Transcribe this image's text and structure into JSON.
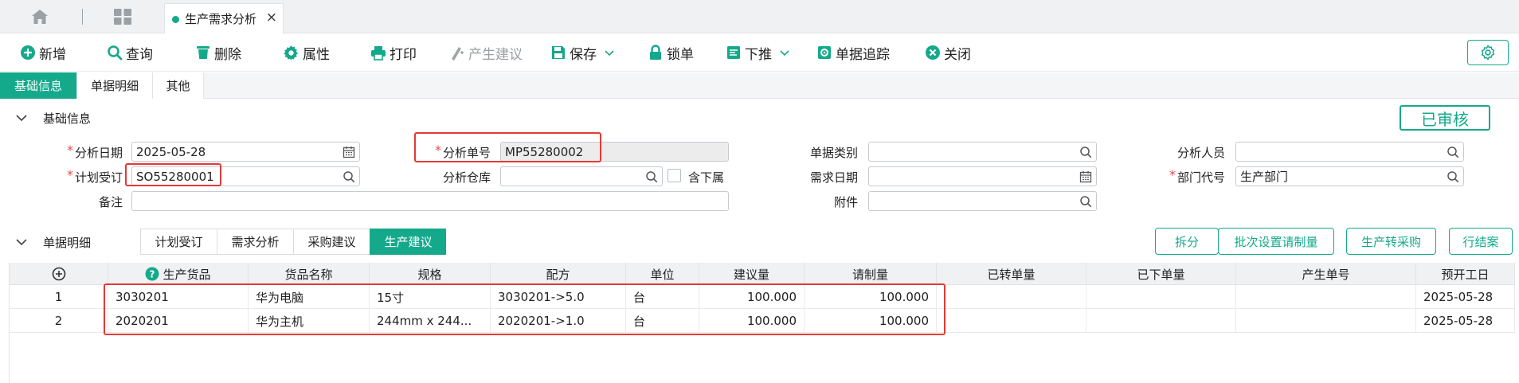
{
  "colors": {
    "accent": "#14a98b",
    "danger": "#e84b4b",
    "highlight": "#e53935"
  },
  "tabbar": {
    "home_icon": "home-icon",
    "grid_icon": "grid-icon",
    "active_tab": "生产需求分析",
    "close_glyph": "×"
  },
  "toolbar": {
    "new": "新增",
    "query": "查询",
    "delete": "删除",
    "props": "属性",
    "print": "打印",
    "generate": "产生建议",
    "save": "保存",
    "lock": "锁单",
    "push": "下推",
    "trace": "单据追踪",
    "close": "关闭"
  },
  "section_tabs": [
    "基础信息",
    "单据明细",
    "其他"
  ],
  "basic": {
    "title": "基础信息",
    "status": "已审核"
  },
  "form": {
    "date_label": "分析日期",
    "date_value": "2025-05-28",
    "plan_label": "计划受订",
    "plan_value": "SO55280001",
    "note_label": "备注",
    "note_value": "",
    "no_label": "分析单号",
    "no_value": "MP55280002",
    "warehouse_label": "分析仓库",
    "warehouse_value": "",
    "sub_label": "含下属",
    "type_label": "单据类别",
    "type_value": "",
    "demand_date_label": "需求日期",
    "demand_date_value": "",
    "attach_label": "附件",
    "attach_value": "",
    "staff_label": "分析人员",
    "staff_value": "",
    "dept_label": "部门代号",
    "dept_value": "生产部门"
  },
  "detail": {
    "title": "单据明细",
    "tabs": [
      "计划受订",
      "需求分析",
      "采购建议",
      "生产建议"
    ],
    "active_tab": 3,
    "actions": [
      "拆分",
      "批次设置请制量",
      "生产转采购",
      "行结案"
    ]
  },
  "table": {
    "headers": [
      "",
      "生产货品",
      "货品名称",
      "规格",
      "配方",
      "单位",
      "建议量",
      "请制量",
      "已转单量",
      "已下单量",
      "产生单号",
      "预开工日"
    ],
    "rows": [
      [
        "1",
        "3030201",
        "华为电脑",
        "15寸",
        "3030201->5.0",
        "台",
        "100.000",
        "100.000",
        "",
        "",
        "",
        "2025-05-28"
      ],
      [
        "2",
        "2020201",
        "华为主机",
        "244mm x 244...",
        "2020201->1.0",
        "台",
        "100.000",
        "100.000",
        "",
        "",
        "",
        "2025-05-28"
      ]
    ]
  }
}
